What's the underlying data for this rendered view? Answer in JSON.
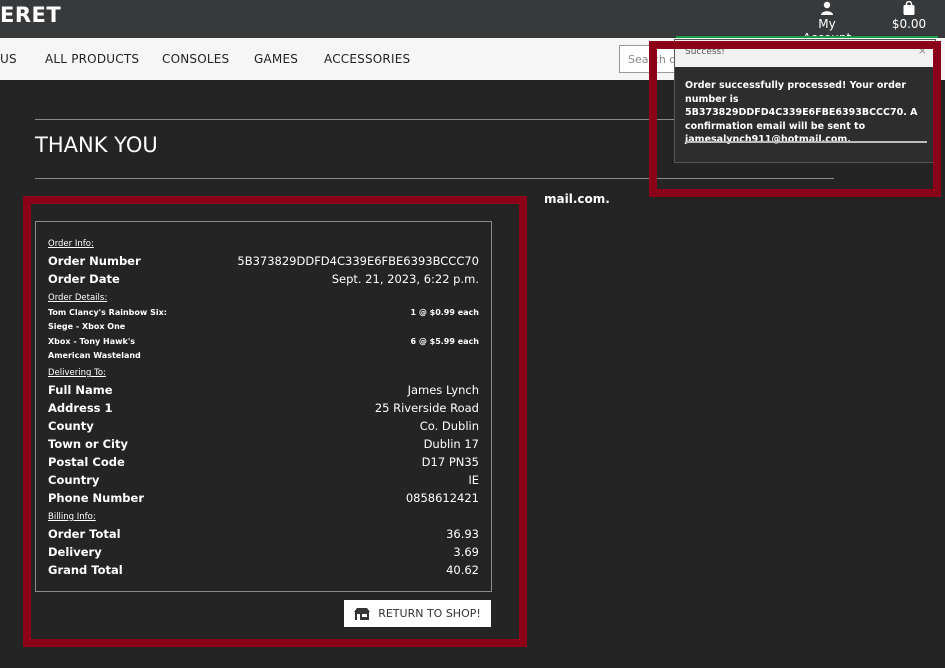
{
  "header": {
    "brand": "ERET",
    "account_label": "My Account",
    "cart_total": "$0.00",
    "account_icon": "user-icon",
    "cart_icon": "shopping-bag-icon"
  },
  "nav": {
    "items": [
      "US",
      "ALL PRODUCTS",
      "CONSOLES",
      "GAMES",
      "ACCESSORIES"
    ],
    "search_placeholder": "Search our site"
  },
  "page": {
    "title": "THANK YOU",
    "email_tail": "mail.com."
  },
  "order": {
    "section_info": "Order Info:",
    "order_number_label": "Order Number",
    "order_number": "5B373829DDFD4C339E6FBE6393BCCC70",
    "order_date_label": "Order Date",
    "order_date": "Sept. 21, 2023, 6:22 p.m.",
    "section_details": "Order Details:",
    "items": [
      {
        "name": "Tom Clancy's Rainbow Six: Siege - Xbox One",
        "qty_price": "1 @ $0.99 each"
      },
      {
        "name": "Xbox - Tony Hawk's American Wasteland",
        "qty_price": "6 @ $5.99 each"
      }
    ],
    "section_delivery": "Delivering To:",
    "delivery": [
      {
        "label": "Full Name",
        "value": "James Lynch"
      },
      {
        "label": "Address 1",
        "value": "25 Riverside Road"
      },
      {
        "label": "County",
        "value": "Co. Dublin"
      },
      {
        "label": "Town or City",
        "value": "Dublin 17"
      },
      {
        "label": "Postal Code",
        "value": "D17 PN35"
      },
      {
        "label": "Country",
        "value": "IE"
      },
      {
        "label": "Phone Number",
        "value": "0858612421"
      }
    ],
    "section_billing": "Billing Info:",
    "billing": [
      {
        "label": "Order Total",
        "value": "36.93"
      },
      {
        "label": "Delivery",
        "value": "3.69"
      },
      {
        "label": "Grand Total",
        "value": "40.62"
      }
    ]
  },
  "button": {
    "label": "RETURN TO SHOP!",
    "icon": "shop-icon"
  },
  "toast": {
    "title": "Success!",
    "close": "×",
    "message": "Order successfully processed! Your order number is 5B373829DDFD4C339E6FBE6393BCCC70. A confirmation email will be sent to jamesalynch911@hotmail.com."
  },
  "colors": {
    "highlight": "#8b0018",
    "background": "#242424",
    "topbar": "#37393b",
    "toast_accent": "#1a9c4a"
  }
}
